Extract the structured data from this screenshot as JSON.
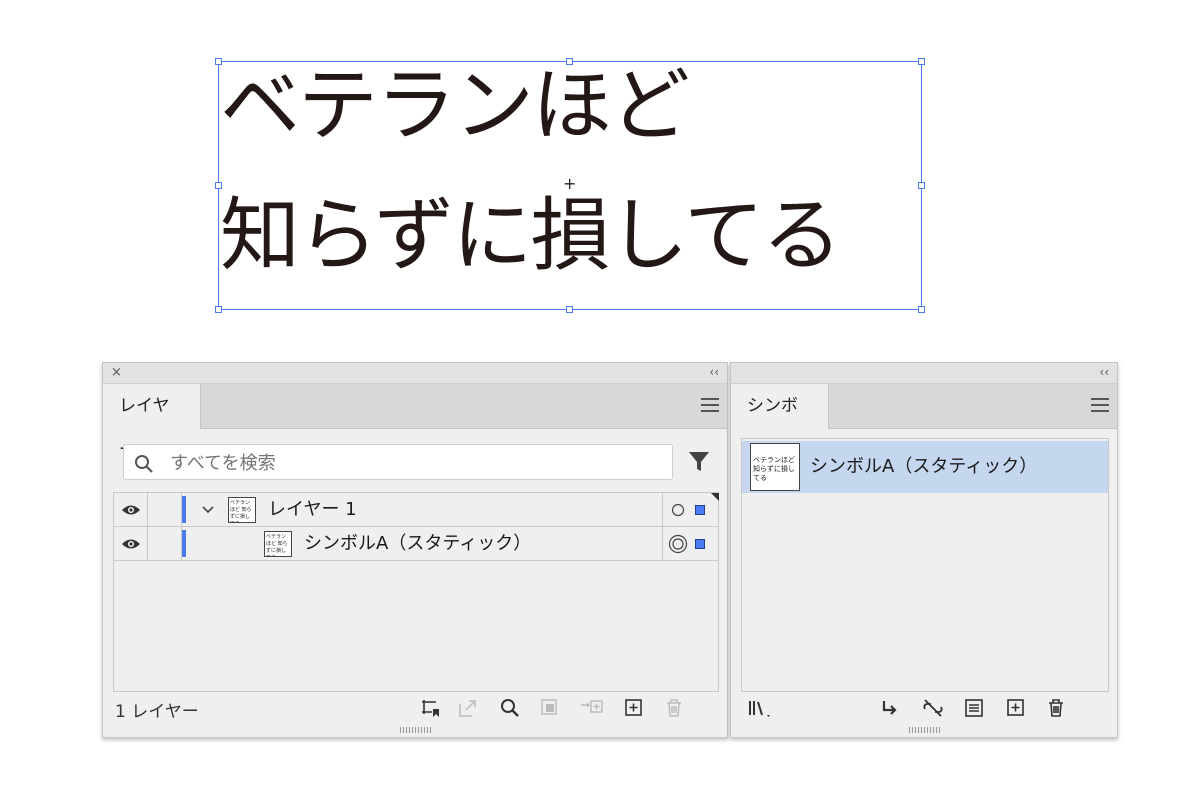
{
  "artwork": {
    "line1": "ベテランほど",
    "line2": "知らずに損してる",
    "center_mark": "+"
  },
  "layers_panel": {
    "close_icon": "×",
    "collapse_icon": "‹‹",
    "tab_label": "レイヤー",
    "search_placeholder": "すべてを検索",
    "rows": [
      {
        "label": "レイヤー 1",
        "thumb_text": "ベテランほど 知らずに損してる",
        "expand_icon": "chevron-down-icon"
      },
      {
        "label": "シンボルA（スタティック）",
        "thumb_text": "ベテランほど 知らずに損してる"
      }
    ],
    "footer_count": "1 レイヤー",
    "accent_color": "#4a7bef"
  },
  "symbols_panel": {
    "collapse_icon": "‹‹",
    "tab_label": "シンボル",
    "items": [
      {
        "label": "シンボルA（スタティック）",
        "thumb_text": "ベテランほど 知らずに損してる"
      }
    ],
    "selected_color": "#c5d6ef"
  }
}
